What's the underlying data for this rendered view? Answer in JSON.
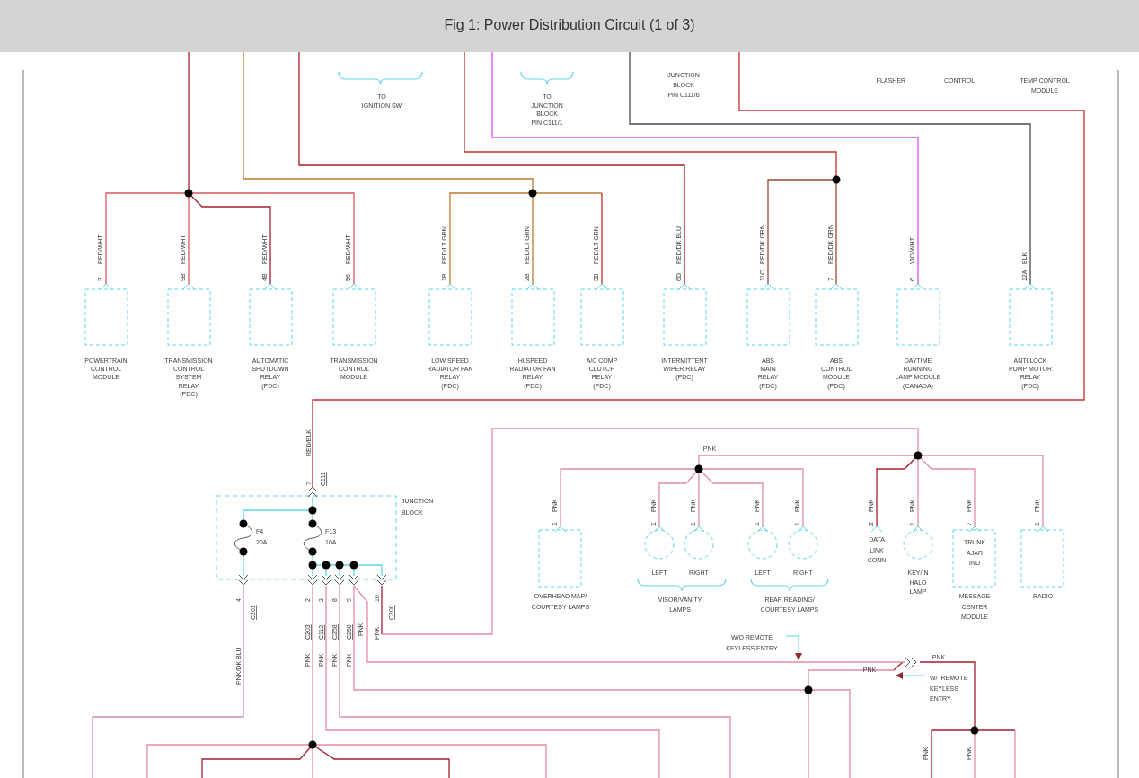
{
  "title": "Fig 1: Power Distribution Circuit (1 of 3)",
  "destinations": [
    {
      "kind": "bracket",
      "lines": [
        "TO",
        "IGNITION SW"
      ]
    },
    {
      "kind": "bracket",
      "lines": [
        "TO",
        "JUNCTION",
        "BLOCK",
        "PIN C111/1"
      ]
    },
    {
      "kind": "plain",
      "lines": [
        "JUNCTION",
        "BLOCK",
        "PIN C111/6"
      ]
    },
    {
      "kind": "plain",
      "lines": [
        "FLASHER"
      ]
    },
    {
      "kind": "plain",
      "lines": [
        "CONTROL"
      ]
    },
    {
      "kind": "plain",
      "lines": [
        "TEMP CONTROL",
        "MODULE"
      ]
    }
  ],
  "upper_components": [
    {
      "lines": [
        "POWERTRAIN",
        "CONTROL",
        "MODULE"
      ],
      "pin": "3",
      "wire": "RED/WHT"
    },
    {
      "lines": [
        "TRANSMISSION",
        "CONTROL",
        "SYSTEM",
        "RELAY",
        "(PDC)"
      ],
      "pin": "9B",
      "wire": "RED/WHT"
    },
    {
      "lines": [
        "AUTOMATIC",
        "SHUTDOWN",
        "RELAY",
        "(PDC)"
      ],
      "pin": "4B",
      "wire": "RED/WHT"
    },
    {
      "lines": [
        "TRANSMISSION",
        "CONTROL",
        "MODULE"
      ],
      "pin": "56",
      "wire": "RED/WHT"
    },
    {
      "lines": [
        "LOW SPEED",
        "RADIATOR FAN",
        "RELAY",
        "(PDC)"
      ],
      "pin": "1B",
      "wire": "RED/LT GRN"
    },
    {
      "lines": [
        "HI SPEED",
        "RADIATOR FAN",
        "RELAY",
        "(PDC)"
      ],
      "pin": "2B",
      "wire": "RED/LT GRN"
    },
    {
      "lines": [
        "A/C COMP",
        "CLUTCH",
        "RELAY",
        "(PDC)"
      ],
      "pin": "3B",
      "wire": "RED/LT GRN"
    },
    {
      "lines": [
        "INTERMITTENT",
        "WIPER RELAY",
        "(PDC)"
      ],
      "pin": "6D",
      "wire": "RED/DK BLU"
    },
    {
      "lines": [
        "ABS",
        "MAIN",
        "RELAY",
        "(PDC)"
      ],
      "pin": "11C",
      "wire": "RED/DK GRN"
    },
    {
      "lines": [
        "ABS",
        "CONTROL",
        "MODULE",
        "(PDC)"
      ],
      "pin": "7",
      "wire": "RED/DK GRN"
    },
    {
      "lines": [
        "DAYTIME",
        "RUNNING",
        "LAMP MODULE",
        "(CANADA)"
      ],
      "pin": "6",
      "wire": "VIO/WHT"
    },
    {
      "lines": [
        "ANTI/LOCK",
        "PUMP MOTOR",
        "RELAY",
        "(PDC)"
      ],
      "pin": "12A",
      "wire": "BLK"
    }
  ],
  "junction_block": {
    "lines": [
      "JUNCTION",
      "BLOCK"
    ],
    "input": {
      "pin": "7",
      "connector": "C111",
      "wire": "RED/BLK"
    },
    "fuses": [
      {
        "name": "F4",
        "rating": "20A"
      },
      {
        "name": "F13",
        "rating": "10A"
      }
    ],
    "outputs": [
      {
        "pin": "4",
        "connector": "C201",
        "wire": "PNK/DK BLU"
      },
      {
        "pin": "2",
        "connector": "C203",
        "wire": "PNK"
      },
      {
        "pin": "2",
        "connector": "C112",
        "wire": "PNK"
      },
      {
        "pin": "8",
        "connector": "C258",
        "wire": "PNK"
      },
      {
        "pin": "9",
        "connector": "C258",
        "wire": "PNK"
      },
      {
        "pin": "10",
        "connector": "C200",
        "wire": "PNK"
      }
    ]
  },
  "lower_components": [
    {
      "kind": "box",
      "lines": [
        "OVERHEAD MAP/",
        "COURTESY LAMPS"
      ],
      "pin": "1",
      "wire": "PNK"
    },
    {
      "kind": "lamp",
      "lines": [
        "LEFT"
      ],
      "pin": "1",
      "wire": "PNK"
    },
    {
      "kind": "lamp",
      "lines": [
        "RIGHT"
      ],
      "pin": "1",
      "wire": "PNK"
    },
    {
      "kind": "lamp",
      "lines": [
        "LEFT"
      ],
      "pin": "1",
      "wire": "PNK"
    },
    {
      "kind": "lamp",
      "lines": [
        "RIGHT"
      ],
      "pin": "1",
      "wire": "PNK"
    },
    {
      "kind": "connector",
      "lines": [
        "DATA",
        "LINK",
        "CONN"
      ],
      "pin": "2",
      "wire": "PNK"
    },
    {
      "kind": "lamp",
      "lines": [
        "KEY/IN",
        "HALO",
        "LAMP"
      ],
      "pin": "1",
      "wire": "PNK"
    },
    {
      "kind": "box",
      "inner_lines": [
        "TRUNK",
        "AJAR",
        "IND"
      ],
      "lines": [
        "MESSAGE",
        "CENTER",
        "MODULE"
      ],
      "pin": "7",
      "wire": "PNK"
    },
    {
      "kind": "box",
      "lines": [
        "RADIO"
      ],
      "pin": "1",
      "wire": "PNK"
    }
  ],
  "groups": [
    {
      "lines": [
        "VISOR/VANITY",
        "LAMPS"
      ]
    },
    {
      "lines": [
        "REAR READING/",
        "COURTESY LAMPS"
      ]
    }
  ],
  "notes": [
    {
      "lines": [
        "W/O REMOTE",
        "KEYLESS ENTRY"
      ]
    },
    {
      "lines": [
        "W/  REMOTE",
        "KEYLESS",
        "ENTRY"
      ]
    }
  ],
  "wire_labels": [
    {
      "kind": "vertical",
      "text": "PNK"
    },
    {
      "kind": "horizontal",
      "text": "PNK"
    },
    {
      "kind": "horizontal",
      "text": "PNK"
    },
    {
      "kind": "horizontal",
      "text": "PNK"
    },
    {
      "kind": "vertical",
      "text": "PNK"
    },
    {
      "kind": "vertical",
      "text": "PNK"
    }
  ]
}
